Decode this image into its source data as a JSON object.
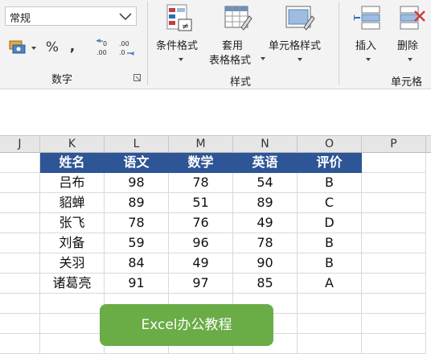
{
  "ribbon": {
    "number_format": {
      "value": "常规"
    },
    "number_buttons": {
      "percent": "%",
      "comma": ","
    },
    "groups": {
      "number": "数字",
      "styles": "样式",
      "cells": "单元格"
    },
    "styles": {
      "conditional": "条件格式",
      "table_line1": "套用",
      "table_line2": "表格格式",
      "cell_styles": "单元格样式"
    },
    "cells": {
      "insert": "插入",
      "delete": "删除"
    }
  },
  "sheet": {
    "columns": [
      "J",
      "K",
      "L",
      "M",
      "N",
      "O",
      "P"
    ],
    "headers": [
      "姓名",
      "语文",
      "数学",
      "英语",
      "评价"
    ],
    "rows": [
      [
        "吕布",
        "98",
        "78",
        "54",
        "B"
      ],
      [
        "貂蝉",
        "89",
        "51",
        "89",
        "C"
      ],
      [
        "张飞",
        "78",
        "76",
        "49",
        "D"
      ],
      [
        "刘备",
        "59",
        "96",
        "78",
        "B"
      ],
      [
        "关羽",
        "84",
        "49",
        "90",
        "B"
      ],
      [
        "诸葛亮",
        "91",
        "97",
        "85",
        "A"
      ]
    ]
  },
  "watermark": "Excel办公教程",
  "colors": {
    "header_fill": "#2e5596",
    "watermark_fill": "#6aac46"
  }
}
